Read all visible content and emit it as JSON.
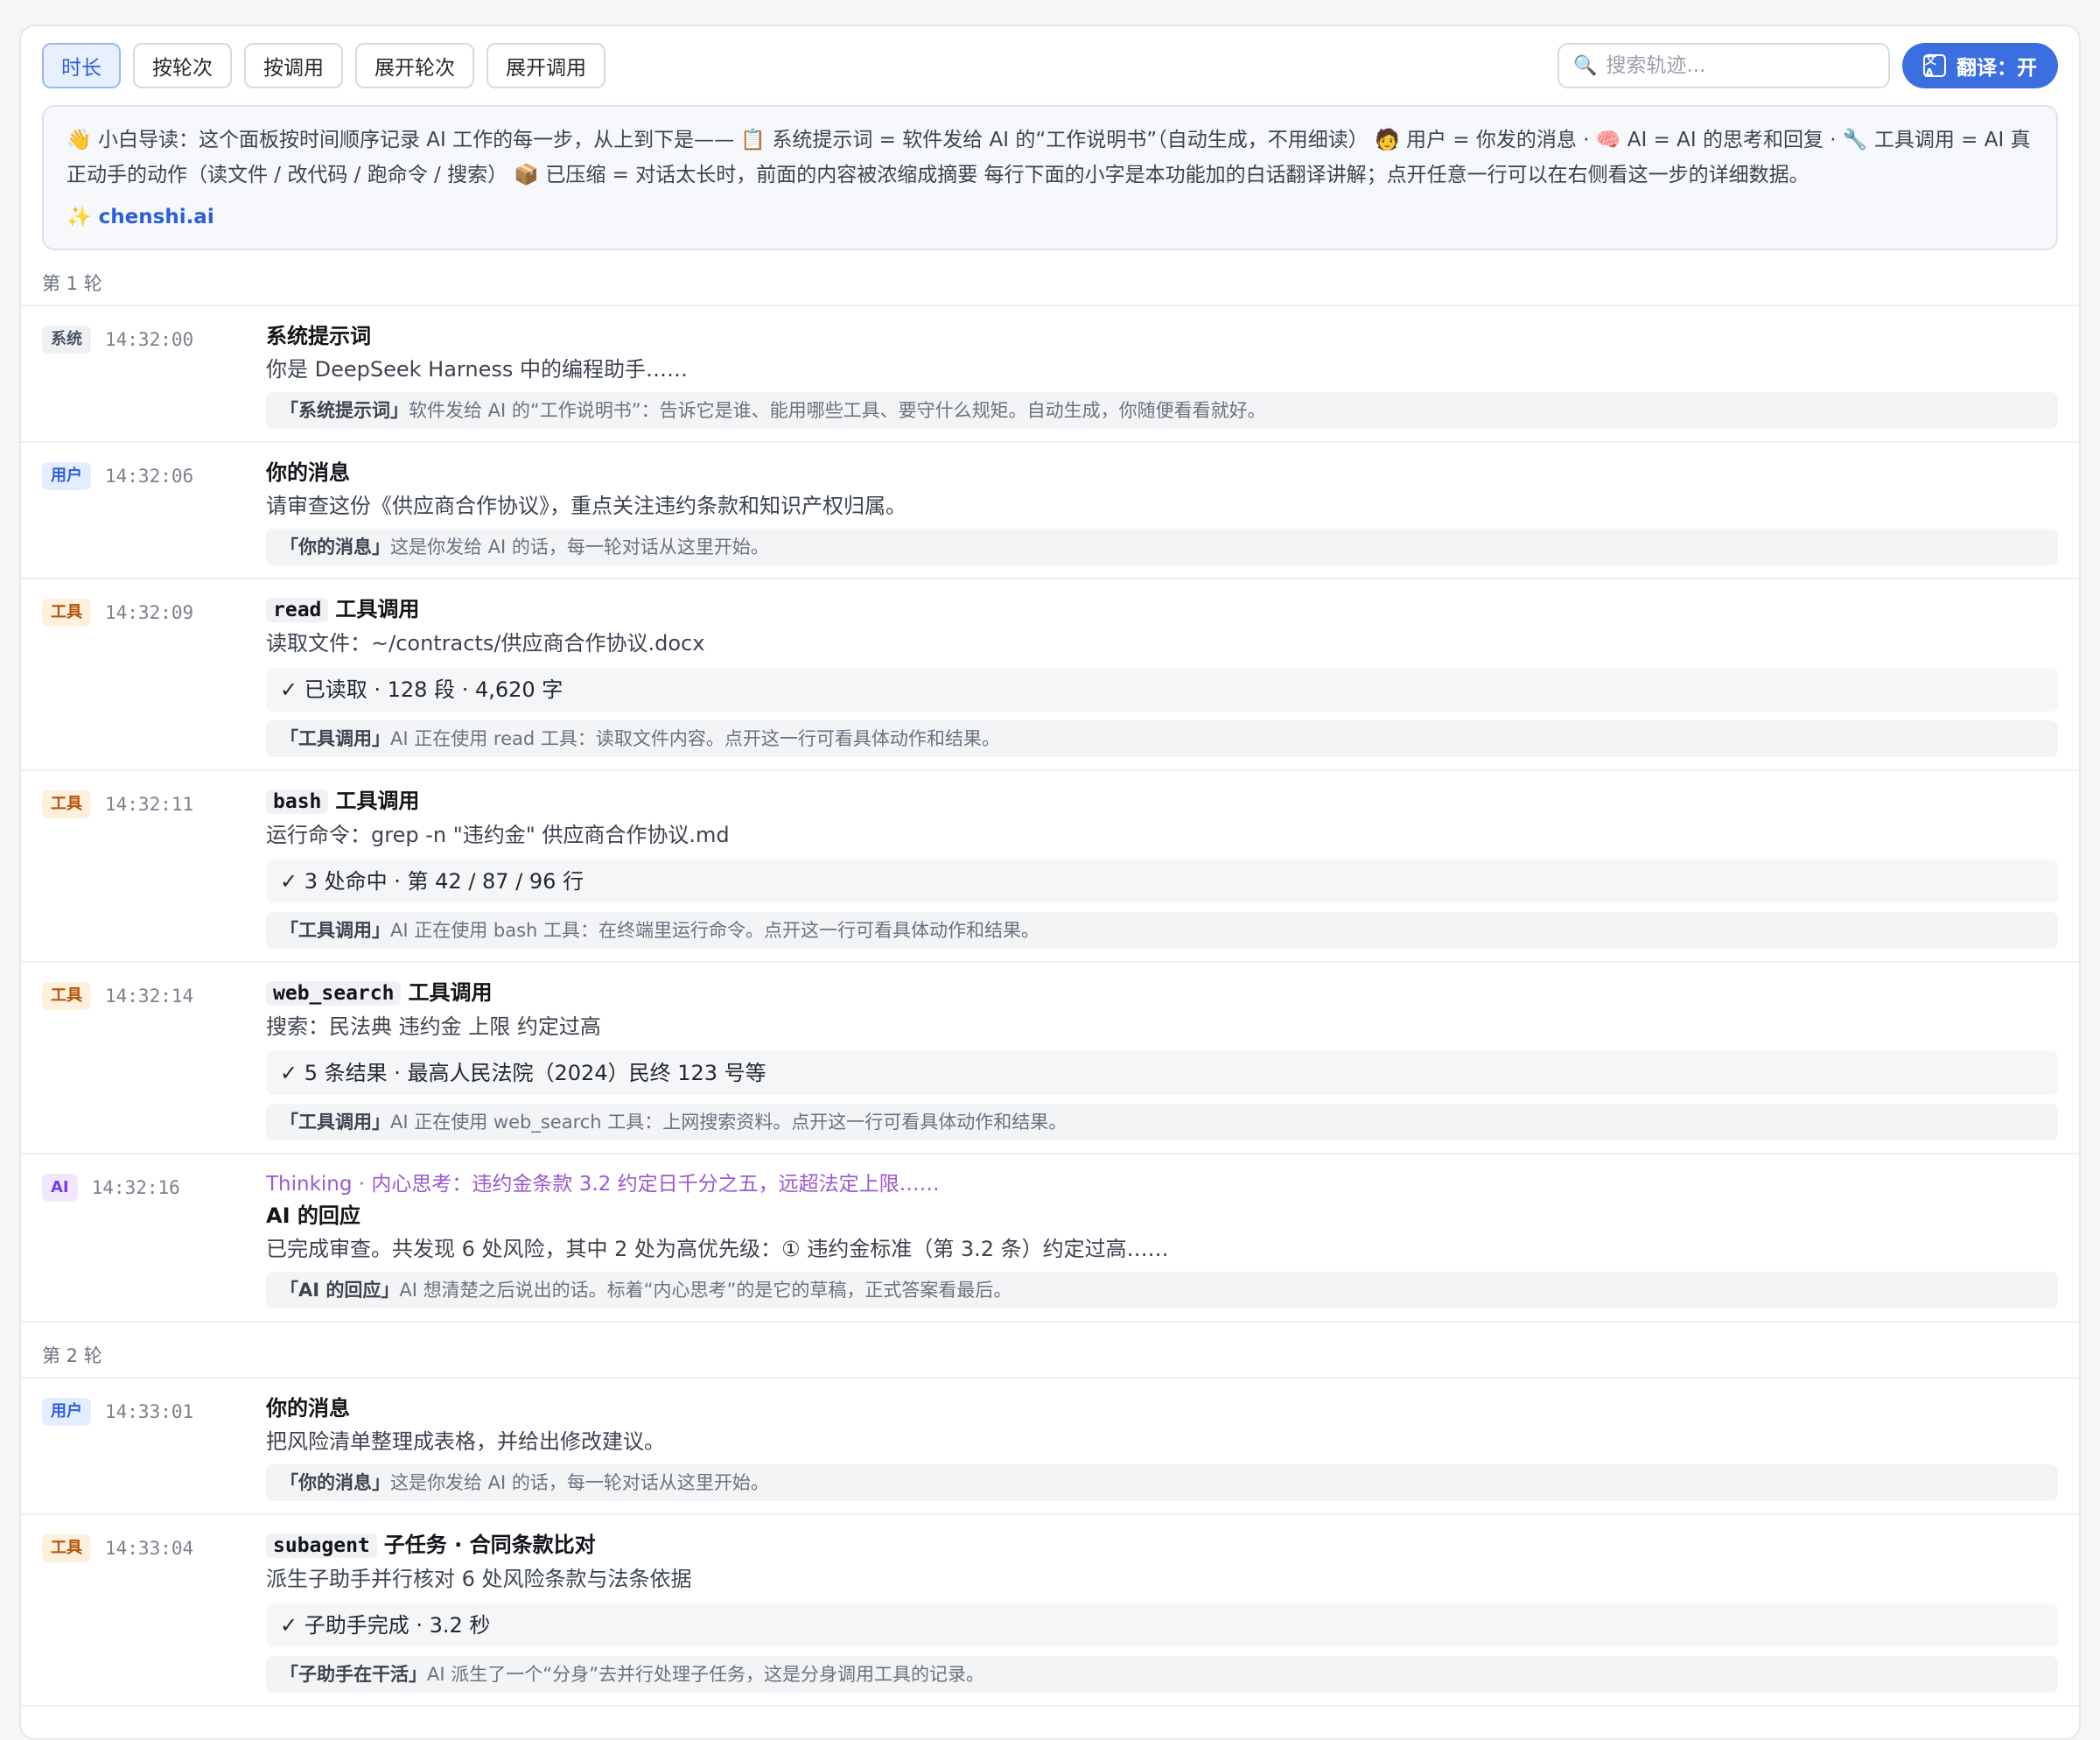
{
  "toolbar": {
    "buttons": [
      "时长",
      "按轮次",
      "按调用",
      "展开轮次",
      "展开调用"
    ],
    "search_placeholder": "搜索轨迹...",
    "translate_label": "翻译：开"
  },
  "guide": {
    "text": "👋 小白导读：这个面板按时间顺序记录 AI 工作的每一步，从上到下是—— 📋 系统提示词 = 软件发给 AI 的“工作说明书”（自动生成，不用细读） 🧑 用户 = 你发的消息 · 🧠 AI = AI 的思考和回复 · 🔧 工具调用 = AI 真正动手的动作（读文件 / 改代码 / 跑命令 / 搜索） 📦 已压缩 = 对话太长时，前面的内容被浓缩成摘要 每行下面的小字是本功能加的白话翻译讲解；点开任意一行可以在右侧看这一步的详细数据。",
    "link": "✨ chenshi.ai"
  },
  "rounds": [
    {
      "label": "第 1 轮",
      "items": [
        {
          "badge": "系统",
          "time": "14:32:00",
          "title": "系统提示词",
          "desc": "你是 DeepSeek Harness 中的编程助手……",
          "note_key": "「系统提示词」",
          "note": "软件发给 AI 的“工作说明书”：告诉它是谁、能用哪些工具、要守什么规矩。自动生成，你随便看看就好。"
        },
        {
          "badge": "用户",
          "time": "14:32:06",
          "title": "你的消息",
          "desc": "请审查这份《供应商合作协议》，重点关注违约条款和知识产权归属。",
          "note_key": "「你的消息」",
          "note": "这是你发给 AI 的话，每一轮对话从这里开始。"
        },
        {
          "badge": "工具",
          "time": "14:32:09",
          "code": "read",
          "title": "工具调用",
          "desc": "读取文件：~/contracts/供应商合作协议.docx",
          "result": "✓ 已读取 · 128 段 · 4,620 字",
          "note_key": "「工具调用」",
          "note": "AI 正在使用 read 工具：读取文件内容。点开这一行可看具体动作和结果。"
        },
        {
          "badge": "工具",
          "time": "14:32:11",
          "code": "bash",
          "title": "工具调用",
          "desc": "运行命令：grep -n \"违约金\" 供应商合作协议.md",
          "result": "✓ 3 处命中 · 第 42 / 87 / 96 行",
          "note_key": "「工具调用」",
          "note": "AI 正在使用 bash 工具：在终端里运行命令。点开这一行可看具体动作和结果。"
        },
        {
          "badge": "工具",
          "time": "14:32:14",
          "code": "web_search",
          "title": "工具调用",
          "desc": "搜索：民法典 违约金 上限 约定过高",
          "result": "✓ 5 条结果 · 最高人民法院（2024）民终 123 号等",
          "note_key": "「工具调用」",
          "note": "AI 正在使用 web_search 工具：上网搜索资料。点开这一行可看具体动作和结果。"
        },
        {
          "badge": "AI",
          "time": "14:32:16",
          "thinking": "Thinking · 内心思考：违约金条款 3.2 约定日千分之五，远超法定上限……",
          "title": "AI 的回应",
          "desc": "已完成审查。共发现 6 处风险，其中 2 处为高优先级：① 违约金标准（第 3.2 条）约定过高……",
          "note_key": "「AI 的回应」",
          "note": "AI 想清楚之后说出的话。标着“内心思考”的是它的草稿，正式答案看最后。"
        }
      ]
    },
    {
      "label": "第 2 轮",
      "items": [
        {
          "badge": "用户",
          "time": "14:33:01",
          "title": "你的消息",
          "desc": "把风险清单整理成表格，并给出修改建议。",
          "note_key": "「你的消息」",
          "note": "这是你发给 AI 的话，每一轮对话从这里开始。"
        },
        {
          "badge": "工具",
          "time": "14:33:04",
          "code": "subagent",
          "title": "子任务 · 合同条款比对",
          "desc": "派生子助手并行核对 6 处风险条款与法条依据",
          "result": "✓ 子助手完成 · 3.2 秒",
          "note_key": "「子助手在干活」",
          "note": "AI 派生了一个“分身”去并行处理子任务，这是分身调用工具的记录。"
        }
      ]
    }
  ]
}
